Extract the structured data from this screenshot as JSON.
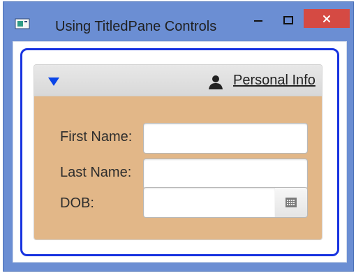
{
  "window": {
    "title": "Using TitledPane Controls",
    "minimize_label": "−",
    "maximize_label": "□",
    "close_label": "×"
  },
  "pane": {
    "title": "Personal Info",
    "expanded": true
  },
  "form": {
    "first_name_label": "First Name:",
    "last_name_label": "Last Name:",
    "dob_label": "DOB:",
    "first_name_value": "",
    "last_name_value": "",
    "dob_value": ""
  },
  "icons": {
    "app": "app-icon",
    "arrow": "expand-arrow-icon",
    "person": "person-icon",
    "calendar": "calendar-icon"
  },
  "colors": {
    "title_bar": "#6b8ed3",
    "close_button": "#d54a43",
    "focus_frame": "#1733e0",
    "pane_content": "#e2b788",
    "arrow": "#0a45e8"
  }
}
